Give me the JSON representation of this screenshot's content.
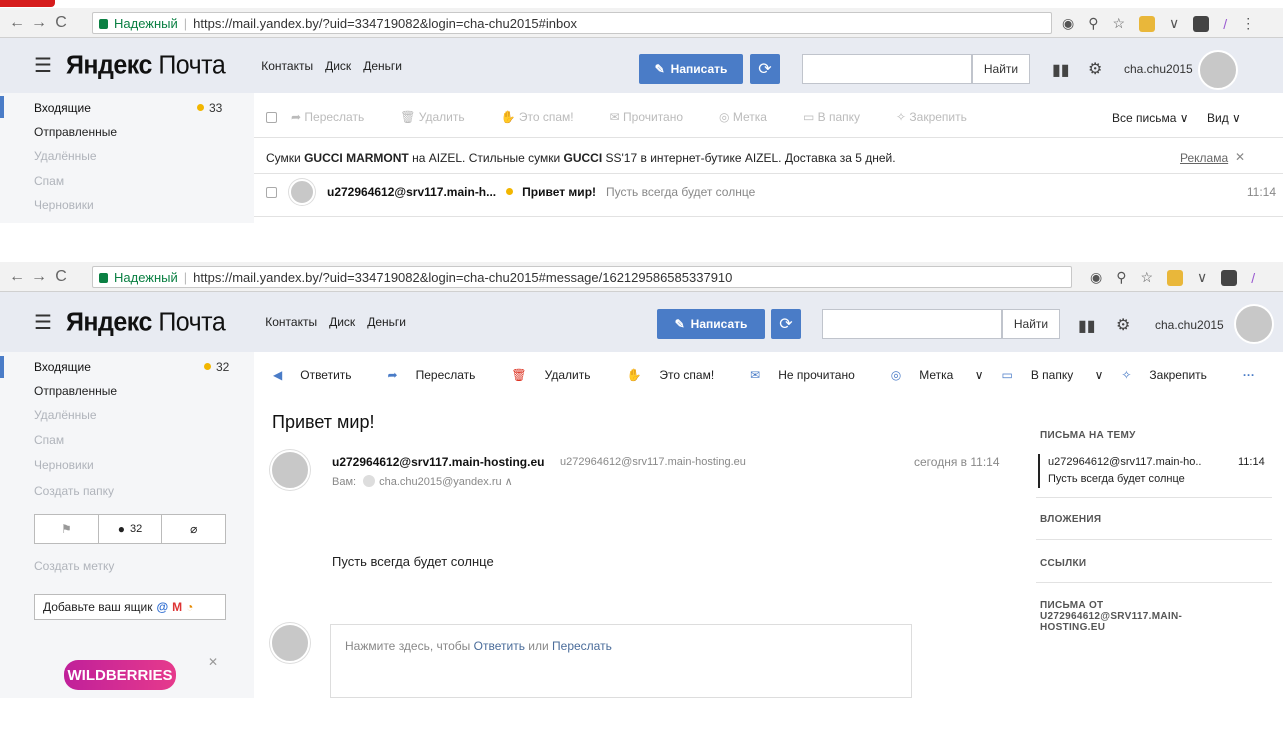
{
  "colors": {
    "accent": "#4a7cc7",
    "header_bg": "#e8ebf2",
    "sidebar_bg": "#f5f6f8",
    "unread_dot": "#f2b600",
    "secure_green": "#0b8043"
  },
  "shot1": {
    "address": {
      "secure_label": "Надежный",
      "url": "https://mail.yandex.by/?uid=334719082&login=cha-chu2015#inbox"
    },
    "header": {
      "logo_bold": "Яндекс",
      "logo_light": "Почта",
      "links": [
        "Контакты",
        "Диск",
        "Деньги"
      ],
      "compose_label": "Написать",
      "search_button": "Найти",
      "username": "cha.chu2015"
    },
    "sidebar": {
      "items": [
        "Входящие",
        "Отправленные",
        "Удалённые",
        "Спам",
        "Черновики"
      ],
      "inbox_count": "33"
    },
    "toolbar": [
      "Переслать",
      "Удалить",
      "Это спам!",
      "Прочитано",
      "Метка",
      "В папку",
      "Закрепить"
    ],
    "toolbar_right": {
      "filter": "Все письма",
      "view": "Вид"
    },
    "ad": {
      "parts": [
        "Сумки ",
        "GUCCI MARMONT",
        " на AIZEL. Стильные сумки ",
        "GUCCI",
        " SS'17 в интернет-бутике AIZEL. Доставка за 5 дней."
      ],
      "link": "Реклама"
    },
    "message_row": {
      "sender": "u272964612@srv117.main-h...",
      "subject": "Привет мир!",
      "snippet": "Пусть всегда будет солнце",
      "time": "11:14"
    }
  },
  "shot2": {
    "address": {
      "secure_label": "Надежный",
      "url": "https://mail.yandex.by/?uid=334719082&login=cha-chu2015#message/162129586585337910"
    },
    "header": {
      "logo_bold": "Яндекс",
      "logo_light": "Почта",
      "links": [
        "Контакты",
        "Диск",
        "Деньги"
      ],
      "compose_label": "Написать",
      "search_button": "Найти",
      "username": "cha.chu2015"
    },
    "sidebar": {
      "items": [
        "Входящие",
        "Отправленные",
        "Удалённые",
        "Спам",
        "Черновики",
        "Создать папку"
      ],
      "inbox_count": "32",
      "filter_unread_count": "32",
      "create_label": "Создать метку",
      "add_mailbox": "Добавьте ваш ящик",
      "ad_brand": "WILDBERRIES"
    },
    "toolbar": [
      "Ответить",
      "Переслать",
      "Удалить",
      "Это спам!",
      "Не прочитано",
      "Метка",
      "В папку",
      "Закрепить"
    ],
    "message": {
      "subject": "Привет мир!",
      "from_name": "u272964612@srv117.main-hosting.eu",
      "from_email": "u272964612@srv117.main-hosting.eu",
      "to_label": "Вам:",
      "to_email": "cha.chu2015@yandex.ru",
      "date": "сегодня в 11:14",
      "body": "Пусть всегда будет солнце",
      "reply_prompt_1": "Нажмите здесь, чтобы ",
      "reply_link_1": "Ответить",
      "reply_prompt_2": " или ",
      "reply_link_2": "Переслать"
    },
    "right_panel": {
      "thread_heading": "ПИСЬМА НА ТЕМУ",
      "thread_sender": "u272964612@srv117.main-ho..",
      "thread_time": "11:14",
      "thread_snippet": "Пусть всегда будет солнце",
      "attachments": "ВЛОЖЕНИЯ",
      "links": "ССЫЛКИ",
      "letters_from": "ПИСЬМА ОТ U272964612@SRV117.MAIN-HOSTING.EU"
    }
  }
}
